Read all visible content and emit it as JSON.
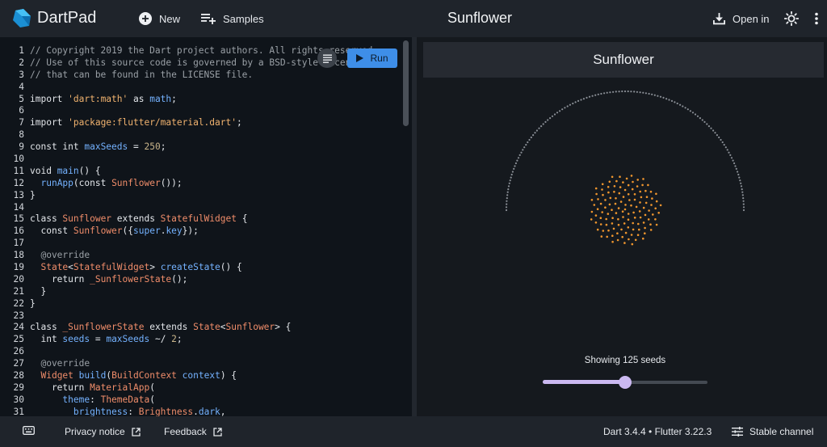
{
  "header": {
    "app_title": "DartPad",
    "new_label": "New",
    "samples_label": "Samples",
    "page_title": "Sunflower",
    "open_in_label": "Open in"
  },
  "editor": {
    "run_label": "Run",
    "lines": [
      {
        "n": "1",
        "t": [
          [
            "c-com",
            "// Copyright 2019 the Dart project authors. All rights reserved."
          ]
        ]
      },
      {
        "n": "2",
        "t": [
          [
            "c-com",
            "// Use of this source code is governed by a BSD-style license"
          ]
        ]
      },
      {
        "n": "3",
        "t": [
          [
            "c-com",
            "// that can be found in the LICENSE file."
          ]
        ]
      },
      {
        "n": "4",
        "t": []
      },
      {
        "n": "5",
        "t": [
          [
            "c-kw",
            "import "
          ],
          [
            "c-str",
            "'dart:math'"
          ],
          [
            "c-kw",
            " as "
          ],
          [
            "c-id",
            "math"
          ],
          [
            "c-kw",
            ";"
          ]
        ]
      },
      {
        "n": "6",
        "t": []
      },
      {
        "n": "7",
        "t": [
          [
            "c-kw",
            "import "
          ],
          [
            "c-str",
            "'package:flutter/material.dart'"
          ],
          [
            "c-kw",
            ";"
          ]
        ]
      },
      {
        "n": "8",
        "t": []
      },
      {
        "n": "9",
        "t": [
          [
            "c-kw",
            "const int "
          ],
          [
            "c-id",
            "maxSeeds"
          ],
          [
            "c-kw",
            " = "
          ],
          [
            "c-num",
            "250"
          ],
          [
            "c-kw",
            ";"
          ]
        ]
      },
      {
        "n": "10",
        "t": []
      },
      {
        "n": "11",
        "t": [
          [
            "c-kw",
            "void "
          ],
          [
            "c-id",
            "main"
          ],
          [
            "c-kw",
            "() {"
          ]
        ]
      },
      {
        "n": "12",
        "t": [
          [
            "c-kw",
            "  "
          ],
          [
            "c-id",
            "runApp"
          ],
          [
            "c-kw",
            "(const "
          ],
          [
            "c-cls",
            "Sunflower"
          ],
          [
            "c-kw",
            "());"
          ]
        ]
      },
      {
        "n": "13",
        "t": [
          [
            "c-kw",
            "}"
          ]
        ]
      },
      {
        "n": "14",
        "t": []
      },
      {
        "n": "15",
        "t": [
          [
            "c-kw",
            "class "
          ],
          [
            "c-cls",
            "Sunflower"
          ],
          [
            "c-kw",
            " extends "
          ],
          [
            "c-cls",
            "StatefulWidget"
          ],
          [
            "c-kw",
            " {"
          ]
        ]
      },
      {
        "n": "16",
        "t": [
          [
            "c-kw",
            "  const "
          ],
          [
            "c-cls",
            "Sunflower"
          ],
          [
            "c-kw",
            "({"
          ],
          [
            "c-id",
            "super"
          ],
          [
            "c-kw",
            "."
          ],
          [
            "c-id",
            "key"
          ],
          [
            "c-kw",
            "});"
          ]
        ]
      },
      {
        "n": "17",
        "t": []
      },
      {
        "n": "18",
        "t": [
          [
            "c-ann",
            "  @override"
          ]
        ]
      },
      {
        "n": "19",
        "t": [
          [
            "c-kw",
            "  "
          ],
          [
            "c-cls",
            "State"
          ],
          [
            "c-kw",
            "<"
          ],
          [
            "c-cls",
            "StatefulWidget"
          ],
          [
            "c-kw",
            "> "
          ],
          [
            "c-id",
            "createState"
          ],
          [
            "c-kw",
            "() {"
          ]
        ]
      },
      {
        "n": "20",
        "t": [
          [
            "c-kw",
            "    return "
          ],
          [
            "c-cls",
            "_SunflowerState"
          ],
          [
            "c-kw",
            "();"
          ]
        ]
      },
      {
        "n": "21",
        "t": [
          [
            "c-kw",
            "  }"
          ]
        ]
      },
      {
        "n": "22",
        "t": [
          [
            "c-kw",
            "}"
          ]
        ]
      },
      {
        "n": "23",
        "t": []
      },
      {
        "n": "24",
        "t": [
          [
            "c-kw",
            "class "
          ],
          [
            "c-cls",
            "_SunflowerState"
          ],
          [
            "c-kw",
            " extends "
          ],
          [
            "c-cls",
            "State"
          ],
          [
            "c-kw",
            "<"
          ],
          [
            "c-cls",
            "Sunflower"
          ],
          [
            "c-kw",
            "> {"
          ]
        ]
      },
      {
        "n": "25",
        "t": [
          [
            "c-kw",
            "  int "
          ],
          [
            "c-id",
            "seeds"
          ],
          [
            "c-kw",
            " = "
          ],
          [
            "c-id",
            "maxSeeds"
          ],
          [
            "c-kw",
            " ~/ "
          ],
          [
            "c-num",
            "2"
          ],
          [
            "c-kw",
            ";"
          ]
        ]
      },
      {
        "n": "26",
        "t": []
      },
      {
        "n": "27",
        "t": [
          [
            "c-ann",
            "  @override"
          ]
        ]
      },
      {
        "n": "28",
        "t": [
          [
            "c-kw",
            "  "
          ],
          [
            "c-cls",
            "Widget"
          ],
          [
            "c-kw",
            " "
          ],
          [
            "c-id",
            "build"
          ],
          [
            "c-kw",
            "("
          ],
          [
            "c-cls",
            "BuildContext"
          ],
          [
            "c-kw",
            " "
          ],
          [
            "c-id",
            "context"
          ],
          [
            "c-kw",
            ") {"
          ]
        ]
      },
      {
        "n": "29",
        "t": [
          [
            "c-kw",
            "    return "
          ],
          [
            "c-cls",
            "MaterialApp"
          ],
          [
            "c-kw",
            "("
          ]
        ]
      },
      {
        "n": "30",
        "t": [
          [
            "c-id",
            "      theme"
          ],
          [
            "c-kw",
            ": "
          ],
          [
            "c-cls",
            "ThemeData"
          ],
          [
            "c-kw",
            "("
          ]
        ]
      },
      {
        "n": "31",
        "t": [
          [
            "c-id",
            "        brightness"
          ],
          [
            "c-kw",
            ": "
          ],
          [
            "c-cls",
            "Brightness"
          ],
          [
            "c-kw",
            "."
          ],
          [
            "c-id",
            "dark"
          ],
          [
            "c-kw",
            ","
          ]
        ]
      }
    ]
  },
  "preview": {
    "appbar_title": "Sunflower",
    "seed_text": "Showing 125 seeds",
    "seeds": 125,
    "max_seeds": 250,
    "seed_color": "#f0962e",
    "ring_color": "#8a8f96",
    "slider_color": "#cbb9f1"
  },
  "footer": {
    "privacy_label": "Privacy notice",
    "feedback_label": "Feedback",
    "version_label": "Dart 3.4.4 • Flutter 3.22.3",
    "channel_label": "Stable channel"
  }
}
